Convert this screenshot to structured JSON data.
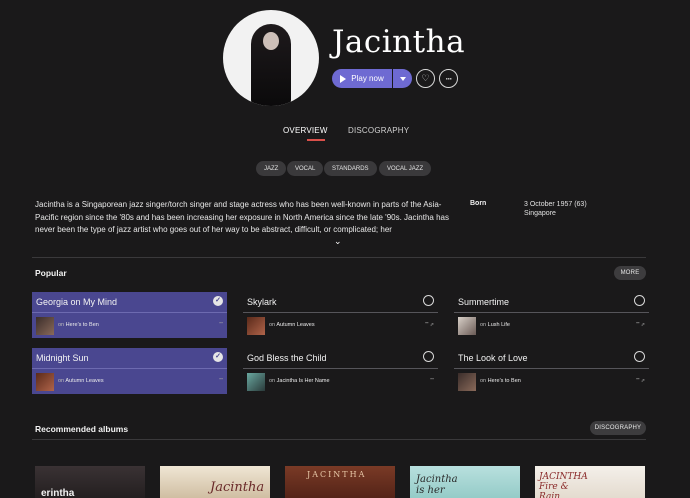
{
  "artist": {
    "name": "Jacintha",
    "play_label": "Play now"
  },
  "tabs": [
    {
      "label": "OVERVIEW",
      "active": true
    },
    {
      "label": "DISCOGRAPHY",
      "active": false
    }
  ],
  "tags": [
    "JAZZ",
    "VOCAL",
    "STANDARDS",
    "VOCAL JAZZ"
  ],
  "bio": {
    "text": "Jacintha is a Singaporean jazz singer/torch singer and stage actress who has been well-known in parts of the Asia-Pacific region since the '80s and has been increasing her exposure in North America since the late '90s. Jacintha has never been the type of jazz artist who goes out of her way to be abstract, difficult, or complicated; her"
  },
  "born": {
    "label": "Born",
    "date": "3 October 1957 (63)",
    "place": "Singapore"
  },
  "popular": {
    "title": "Popular",
    "more_label": "MORE",
    "tracks": [
      {
        "title": "Georgia on My Mind",
        "on_prefix": "on",
        "album": "Here's to Ben",
        "selected": true,
        "meta": "'\"'"
      },
      {
        "title": "Skylark",
        "on_prefix": "on",
        "album": "Autumn Leaves",
        "selected": false,
        "meta": "'\"' ⇗"
      },
      {
        "title": "Summertime",
        "on_prefix": "on",
        "album": "Lush Life",
        "selected": false,
        "meta": "'\"' ⇗"
      },
      {
        "title": "Midnight Sun",
        "on_prefix": "on",
        "album": "Autumn Leaves",
        "selected": true,
        "meta": "'\"'"
      },
      {
        "title": "God Bless the Child",
        "on_prefix": "on",
        "album": "Jacintha Is Her Name",
        "selected": false,
        "meta": "'\"'"
      },
      {
        "title": "The Look of Love",
        "on_prefix": "on",
        "album": "Here's to Ben",
        "selected": false,
        "meta": "'\"' ⇗"
      }
    ]
  },
  "recommended": {
    "title": "Recommended albums",
    "discography_label": "DISCOGRAPHY",
    "albums": [
      {
        "text": "erintha",
        "bg": "#2a2426"
      },
      {
        "text": "Jacintha",
        "bg": "#e8dcc8"
      },
      {
        "text": "JACINTHA",
        "bg": "#6a2f22"
      },
      {
        "text": "Jacintha is her",
        "bg": "#a9d6d4"
      },
      {
        "text": "JACINTHA Fire & Rain",
        "bg": "#f1ece4"
      }
    ]
  },
  "colors": {
    "accent": "#6e6ad2",
    "selected_row": "#4a4790",
    "tab_underline": "#d9504a",
    "background": "#1a191a"
  },
  "icons": {
    "play": "play-icon",
    "dropdown": "chevron-down-icon",
    "heart": "heart-icon",
    "more": "more-icon",
    "check": "check-icon",
    "circle": "circle-outline-icon"
  }
}
